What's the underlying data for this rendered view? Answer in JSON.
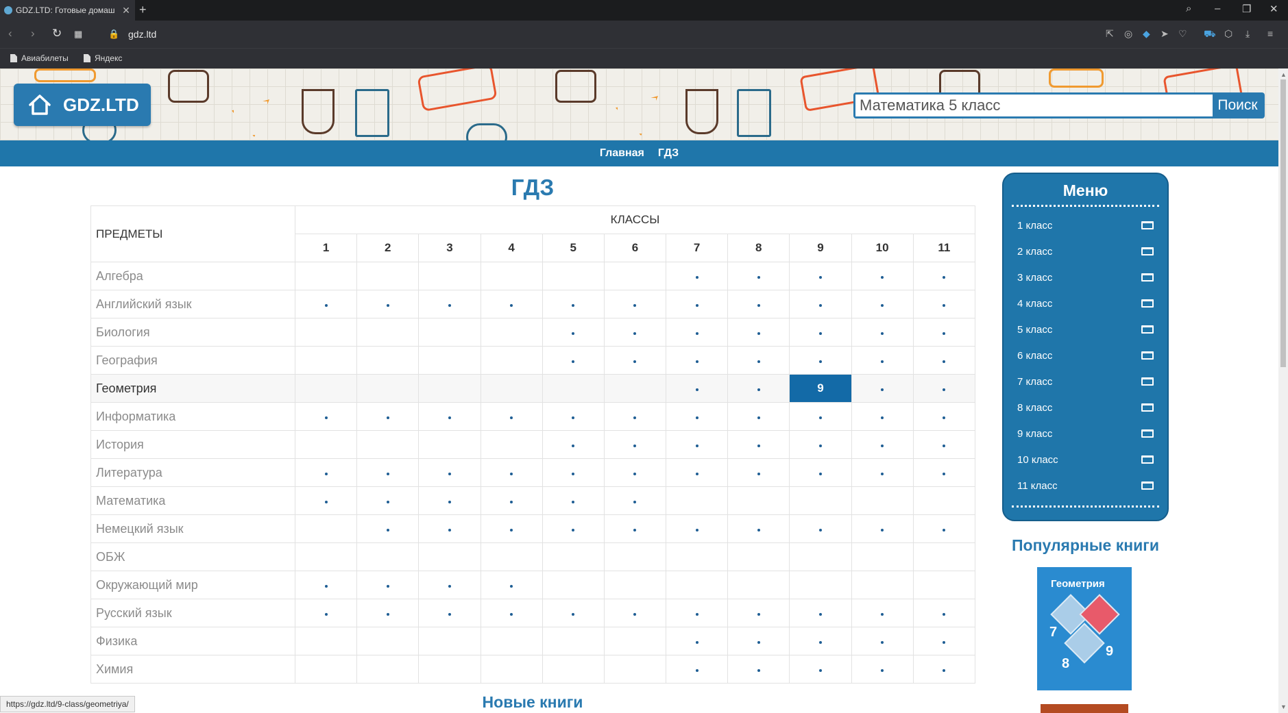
{
  "browser": {
    "tab_title": "GDZ.LTD: Готовые домаш",
    "url": "gdz.ltd",
    "bookmarks": [
      "Авиабилеты",
      "Яндекс"
    ]
  },
  "site": {
    "logo_text": "GDZ.LTD",
    "search_value": "Математика 5 класс",
    "search_button": "Поиск",
    "nav": [
      "Главная",
      "ГДЗ"
    ]
  },
  "main": {
    "title": "ГДЗ",
    "subjects_header": "ПРЕДМЕТЫ",
    "classes_header": "КЛАССЫ",
    "grades": [
      "1",
      "2",
      "3",
      "4",
      "5",
      "6",
      "7",
      "8",
      "9",
      "10",
      "11"
    ],
    "highlighted_row": "Геометрия",
    "active_cell": {
      "subject": "Геометрия",
      "grade": "9"
    },
    "rows": [
      {
        "subject": "Алгебра",
        "grades": [
          7,
          8,
          9,
          10,
          11
        ]
      },
      {
        "subject": "Английский язык",
        "grades": [
          1,
          2,
          3,
          4,
          5,
          6,
          7,
          8,
          9,
          10,
          11
        ]
      },
      {
        "subject": "Биология",
        "grades": [
          5,
          6,
          7,
          8,
          9,
          10,
          11
        ]
      },
      {
        "subject": "География",
        "grades": [
          5,
          6,
          7,
          8,
          9,
          10,
          11
        ]
      },
      {
        "subject": "Геометрия",
        "grades": [
          7,
          8,
          9,
          10,
          11
        ]
      },
      {
        "subject": "Информатика",
        "grades": [
          1,
          2,
          3,
          4,
          5,
          6,
          7,
          8,
          9,
          10,
          11
        ]
      },
      {
        "subject": "История",
        "grades": [
          5,
          6,
          7,
          8,
          9,
          10,
          11
        ]
      },
      {
        "subject": "Литература",
        "grades": [
          1,
          2,
          3,
          4,
          5,
          6,
          7,
          8,
          9,
          10,
          11
        ]
      },
      {
        "subject": "Математика",
        "grades": [
          1,
          2,
          3,
          4,
          5,
          6
        ]
      },
      {
        "subject": "Немецкий язык",
        "grades": [
          2,
          3,
          4,
          5,
          6,
          7,
          8,
          9,
          10,
          11
        ]
      },
      {
        "subject": "ОБЖ",
        "grades": []
      },
      {
        "subject": "Окружающий мир",
        "grades": [
          1,
          2,
          3,
          4
        ]
      },
      {
        "subject": "Русский язык",
        "grades": [
          1,
          2,
          3,
          4,
          5,
          6,
          7,
          8,
          9,
          10,
          11
        ]
      },
      {
        "subject": "Физика",
        "grades": [
          7,
          8,
          9,
          10,
          11
        ]
      },
      {
        "subject": "Химия",
        "grades": [
          7,
          8,
          9,
          10,
          11
        ]
      }
    ],
    "new_books_title": "Новые книги"
  },
  "sidebar": {
    "menu_title": "Меню",
    "menu_items": [
      "1 класс",
      "2 класс",
      "3 класс",
      "4 класс",
      "5 класс",
      "6 класс",
      "7 класс",
      "8 класс",
      "9 класс",
      "10 класс",
      "11 класс"
    ],
    "popular_title": "Популярные книги",
    "book_cover_title": "Геометрия",
    "book_cover_numbers": [
      "7",
      "8",
      "9"
    ]
  },
  "status_url": "https://gdz.ltd/9-class/geometriya/",
  "colors": {
    "brand_blue": "#2a7ab0",
    "nav_blue": "#1f76aa",
    "active_cell": "#136aa7"
  }
}
